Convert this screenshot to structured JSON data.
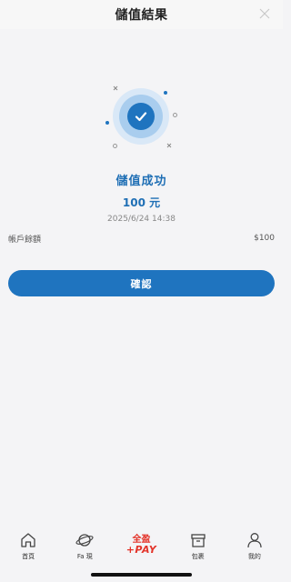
{
  "header": {
    "title": "儲值結果"
  },
  "result": {
    "status_title": "儲值成功",
    "amount": "100 元",
    "timestamp": "2025/6/24 14:38",
    "balance_label": "帳戶餘額",
    "balance_value": "$100"
  },
  "actions": {
    "confirm_label": "確認"
  },
  "bottom_nav": {
    "items": [
      {
        "label": "首頁",
        "icon": "home-icon"
      },
      {
        "label": "Fa 現",
        "icon": "planet-icon"
      },
      {
        "label": "全盈+PAY",
        "icon": "pay-logo",
        "top": "全盈",
        "bottom": "+PAY"
      },
      {
        "label": "包裹",
        "icon": "package-icon"
      },
      {
        "label": "我的",
        "icon": "user-icon"
      }
    ]
  },
  "colors": {
    "accent": "#1f74bf",
    "pay_red": "#e3342a",
    "background": "#f4f4f6"
  }
}
